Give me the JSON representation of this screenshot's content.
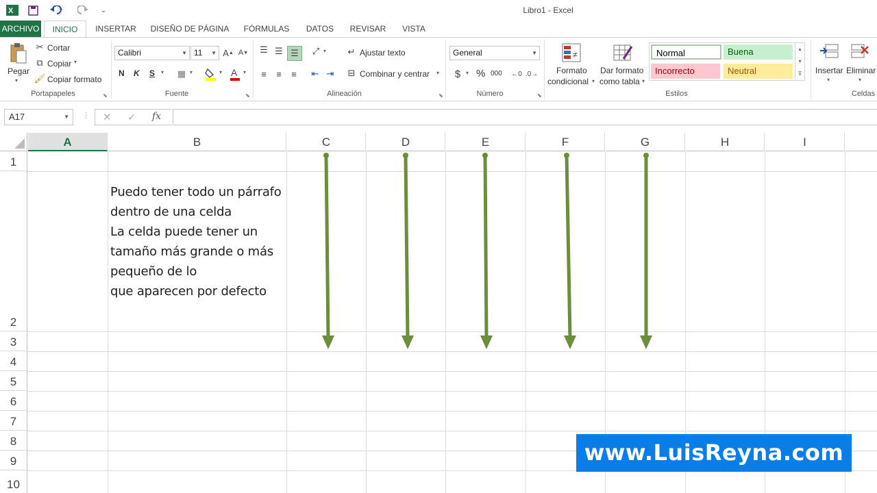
{
  "window": {
    "title": "Libro1 - Excel"
  },
  "quick_access": {
    "undo_icon": "undo-icon",
    "redo_icon": "redo-icon",
    "save_icon": "save-icon",
    "excel_icon": "excel-logo-icon"
  },
  "tabs": [
    {
      "label": "ARCHIVO"
    },
    {
      "label": "INICIO"
    },
    {
      "label": "INSERTAR"
    },
    {
      "label": "DISEÑO DE PÁGINA"
    },
    {
      "label": "FÓRMULAS"
    },
    {
      "label": "DATOS"
    },
    {
      "label": "REVISAR"
    },
    {
      "label": "VISTA"
    }
  ],
  "ribbon": {
    "portapapeles": {
      "label": "Portapapeles",
      "paste": "Pegar",
      "cut": "Cortar",
      "copy": "Copiar",
      "format_painter": "Copiar formato"
    },
    "fuente": {
      "label": "Fuente",
      "font_name": "Calibri",
      "font_size": "11",
      "bold": "N",
      "italic": "K",
      "underline": "S"
    },
    "alineacion": {
      "label": "Alineación",
      "wrap_text": "Ajustar texto",
      "merge_center": "Combinar y centrar"
    },
    "numero": {
      "label": "Número",
      "format": "General",
      "percent": "%",
      "thousands": "000"
    },
    "estilos": {
      "label": "Estilos",
      "conditional_1": "Formato",
      "conditional_2": "condicional",
      "table_1": "Dar formato",
      "table_2": "como tabla",
      "styles": [
        {
          "label": "Normal",
          "bg": "#ffffff",
          "fg": "#000000"
        },
        {
          "label": "Buena",
          "bg": "#c6efce",
          "fg": "#006100"
        },
        {
          "label": "Incorrecto",
          "bg": "#ffc7ce",
          "fg": "#9c0006"
        },
        {
          "label": "Neutral",
          "bg": "#ffeb9c",
          "fg": "#9c5700"
        }
      ]
    },
    "celdas": {
      "label": "Celdas",
      "insert": "Insertar",
      "delete": "Eliminar"
    }
  },
  "formula_bar": {
    "name_box": "A17",
    "fx": "fx",
    "value": ""
  },
  "sheet": {
    "columns": [
      "A",
      "B",
      "C",
      "D",
      "E",
      "F",
      "G",
      "H",
      "I"
    ],
    "selected_column": "A",
    "rows": [
      "1",
      "2",
      "3",
      "4",
      "5",
      "6",
      "7",
      "8",
      "9",
      "10"
    ],
    "cell_b2_lines": [
      "Puedo tener todo un párrafo",
      "dentro de una celda",
      "La celda puede tener un",
      "tamaño más grande o más",
      "pequeño de lo",
      "que aparecen por defecto"
    ],
    "arrow_color": "#6b8e3a",
    "arrow_columns": [
      "C",
      "D",
      "E",
      "F",
      "G"
    ]
  },
  "watermark": {
    "text": "www.LuisReyna.com",
    "bg": "#0a7de6"
  },
  "colors": {
    "accent": "#217346"
  }
}
